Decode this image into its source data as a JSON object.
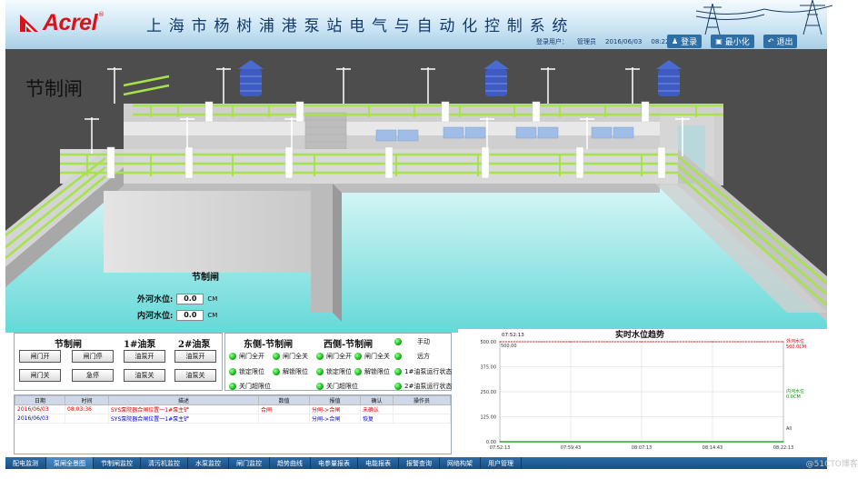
{
  "header": {
    "brand": "Acrel",
    "brand_mark": "®",
    "system_title": "上海市杨树浦港泵站电气与自动化控制系统",
    "user_label": "登录用户：",
    "user_name": "管理员",
    "date": "2016/06/03",
    "time": "08:22:14.0",
    "login": "登录",
    "minimize": "最小化",
    "exit": "退出",
    "brand_color": "#d7141a"
  },
  "scene": {
    "label": "节制闸",
    "wall_label": "节制闸",
    "outer_level_label": "外河水位:",
    "outer_level_value": "0.0",
    "inner_level_label": "内河水位:",
    "inner_level_value": "0.0",
    "unit": "CM"
  },
  "control": {
    "gate_header": "节制闸",
    "pump1_header": "1#油泵",
    "pump2_header": "2#油泵",
    "gate_open": "闸门开",
    "gate_stop": "闸门停",
    "gate_close": "闸门关",
    "emergency_stop": "急停",
    "pump1_open": "油泵开",
    "pump1_close": "油泵关",
    "pump2_open": "油泵开",
    "pump2_close": "油泵关"
  },
  "status": {
    "east_header": "东侧-节制闸",
    "west_header": "西侧-节制闸",
    "east": [
      "闸门全开",
      "闸门全关",
      "锁定限位",
      "解锁限位",
      "关门超限位"
    ],
    "west": [
      "闸门全开",
      "闸门全关",
      "锁定限位",
      "解锁限位",
      "关门超限位"
    ],
    "side": [
      "手动",
      "远方",
      "1#油泵运行状态",
      "2#油泵运行状态"
    ],
    "indicator_color": "#00aa00"
  },
  "alarm": {
    "columns": [
      "日期",
      "时间",
      "描述",
      "数值",
      "报值",
      "确认",
      "操作员"
    ],
    "rows": [
      [
        "2016/06/03",
        "08:03:36",
        "SYS泵院器合闸位置一1#泵主铲",
        "合闸",
        "分闸->合闸",
        "未确认",
        ""
      ],
      [
        "2016/06/03",
        "",
        "SYS泵院器合闸位置一1#泵主铲",
        "",
        "分闸->合闸",
        "恢复",
        ""
      ]
    ],
    "row_colors": [
      "#d00000",
      "#0000cc"
    ]
  },
  "chart_data": {
    "type": "line",
    "title": "实时水位趋势",
    "start_label": "07:52:13",
    "x": [
      "07:52:13",
      "07:59:43",
      "08:07:13",
      "08:14:43",
      "08:22:13"
    ],
    "y_ticks": [
      "0.00",
      "125.00",
      "250.00",
      "375.00",
      "500.00"
    ],
    "ylim": [
      0,
      500
    ],
    "series": [
      {
        "name": "外河水位",
        "value_label": "500.0CM",
        "color": "#cc0000",
        "values": [
          500,
          500,
          500,
          500,
          500
        ]
      },
      {
        "name": "内河水位",
        "value_label": "0.0CM",
        "color": "#009900",
        "values": [
          0,
          0,
          0,
          0,
          0
        ]
      }
    ],
    "inline_values": [
      "500.00"
    ],
    "x_tag": "All"
  },
  "nav": {
    "items": [
      "配电监测",
      "泵闸全景图",
      "节制闸监控",
      "清污机监控",
      "水泵监控",
      "闸门监控",
      "趋势曲线",
      "电参量报表",
      "电能报表",
      "报警查询",
      "网络构架",
      "用户管理"
    ],
    "active": 1
  },
  "watermark": "@51CTO博客"
}
